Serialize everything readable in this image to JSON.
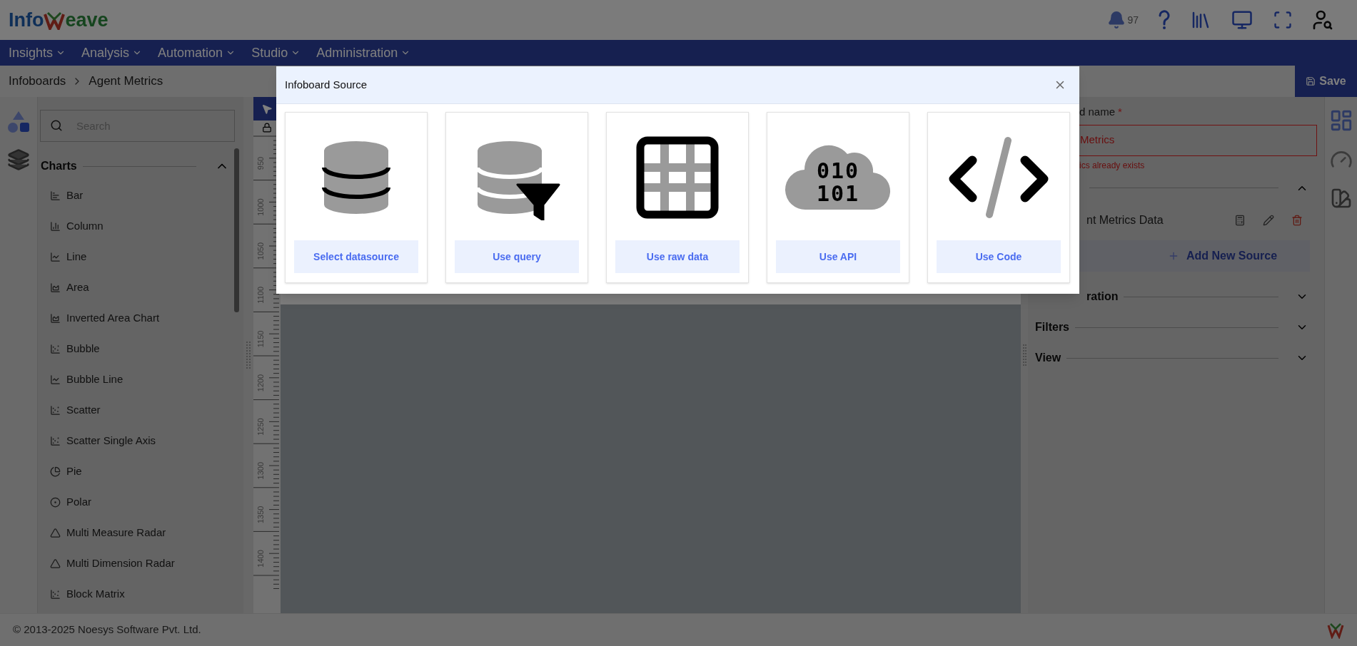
{
  "header": {
    "logo": {
      "left": "Info",
      "right": "eave"
    },
    "notifications": {
      "count": "97"
    }
  },
  "nav": [
    {
      "label": "Insights"
    },
    {
      "label": "Analysis"
    },
    {
      "label": "Automation"
    },
    {
      "label": "Studio"
    },
    {
      "label": "Administration"
    }
  ],
  "breadcrumb": [
    "Infoboards",
    "Agent Metrics"
  ],
  "save_button": "Save",
  "sidebar": {
    "search": {
      "placeholder": "Search"
    },
    "section": {
      "title": "Charts",
      "expanded": true
    },
    "items": [
      {
        "label": "Bar",
        "kind": "bar"
      },
      {
        "label": "Column",
        "kind": "column"
      },
      {
        "label": "Line",
        "kind": "line"
      },
      {
        "label": "Area",
        "kind": "area"
      },
      {
        "label": "Inverted Area Chart",
        "kind": "area"
      },
      {
        "label": "Bubble",
        "kind": "bubble"
      },
      {
        "label": "Bubble Line",
        "kind": "line"
      },
      {
        "label": "Scatter",
        "kind": "scatter"
      },
      {
        "label": "Scatter Single Axis",
        "kind": "scatter"
      },
      {
        "label": "Pie",
        "kind": "pie"
      },
      {
        "label": "Polar",
        "kind": "polar"
      },
      {
        "label": "Multi Measure Radar",
        "kind": "radar"
      },
      {
        "label": "Multi Dimension Radar",
        "kind": "radar"
      },
      {
        "label": "Block Matrix",
        "kind": "scatter"
      }
    ]
  },
  "ruler": {
    "labels": [
      "950",
      "1000",
      "1050",
      "1100",
      "1150",
      "1200",
      "1250",
      "1300",
      "1350",
      "1400"
    ]
  },
  "right_panel": {
    "name_field": {
      "label": "d name",
      "required_mark": "*",
      "value": "Metrics",
      "invalid": true,
      "error": "ics already exists"
    },
    "sources_section": {
      "expanded": true
    },
    "sources": [
      {
        "name": "nt Metrics Data"
      }
    ],
    "add_source": "Add New Source",
    "sections": [
      {
        "title": "ration",
        "expanded": false
      },
      {
        "title": "Filters",
        "expanded": false
      },
      {
        "title": "View",
        "expanded": false
      }
    ]
  },
  "modal": {
    "title": "Infoboard Source",
    "options": [
      {
        "kind": "datasource",
        "label": "Select datasource"
      },
      {
        "kind": "query",
        "label": "Use query"
      },
      {
        "kind": "raw",
        "label": "Use raw data"
      },
      {
        "kind": "api",
        "label": "Use API",
        "icon_text": [
          "010",
          "101"
        ]
      },
      {
        "kind": "code",
        "label": "Use Code"
      }
    ]
  },
  "footer": {
    "copyright": "© 2013-2025 Noesys Software Pvt. Ltd."
  }
}
